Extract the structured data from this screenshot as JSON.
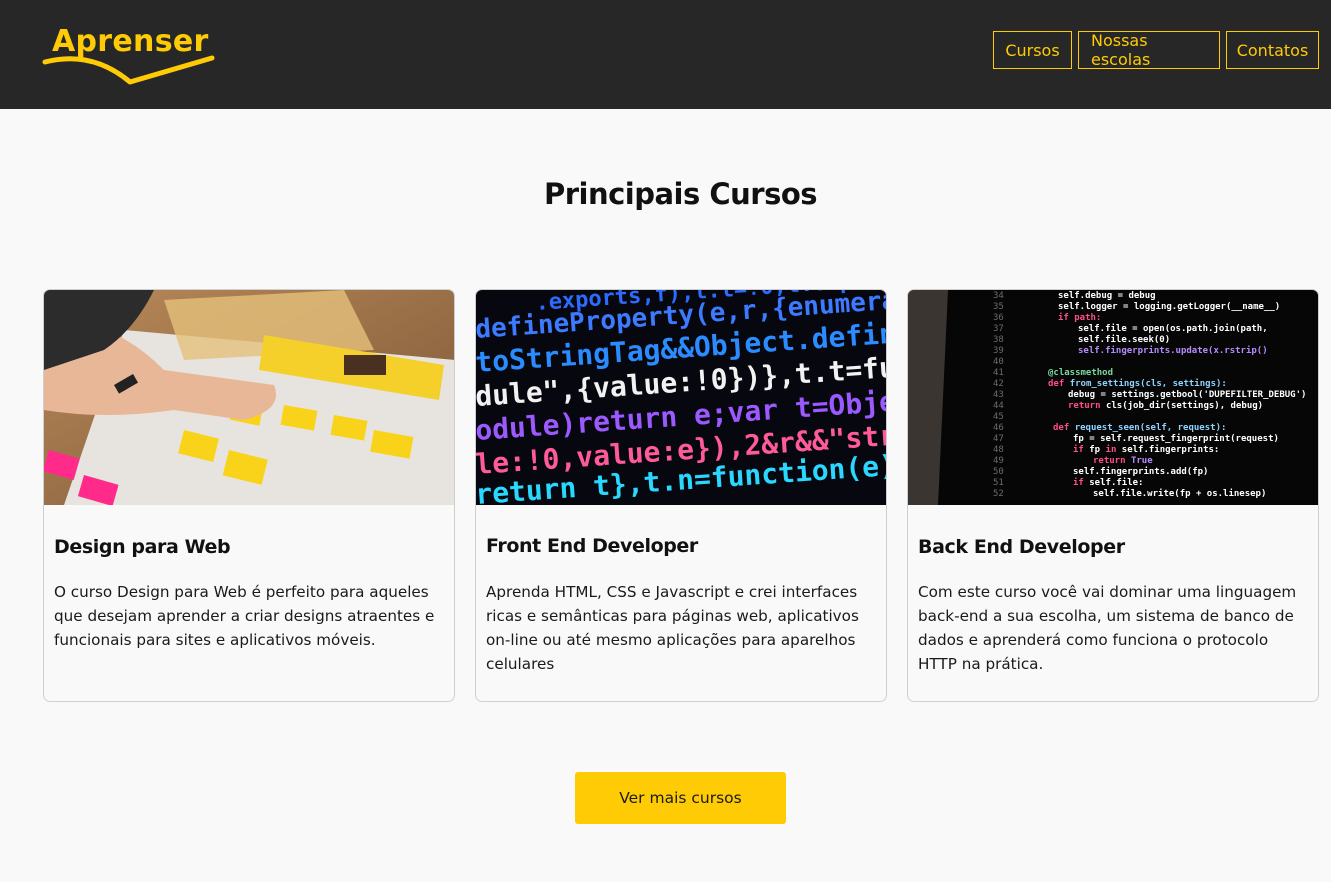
{
  "header": {
    "logo_text": "Aprenser",
    "nav": [
      "Cursos",
      "Nossas escolas",
      "Contatos"
    ]
  },
  "main": {
    "title": "Principais Cursos",
    "courses": [
      {
        "title": "Design para Web",
        "description": "O curso Design para Web é perfeito para aqueles que desejam aprender a criar designs atraentes e funcionais para sites e aplicativos móveis."
      },
      {
        "title": "Front End Developer",
        "description": "Aprenda HTML, CSS e Javascript e crei interfaces ricas e semânticas para páginas web, aplicativos on-line ou até mesmo aplicações para aparelhos celulares"
      },
      {
        "title": "Back End Developer",
        "description": "Com este curso você vai dominar uma linguagem back-end a sua escolha, um sistema de banco de dados e aprenderá como funciona o protocolo HTTP na prática."
      }
    ],
    "more_button": "Ver mais cursos"
  },
  "colors": {
    "accent": "#ffcb05",
    "header_bg": "#272727",
    "page_bg": "#f9f9f9"
  }
}
